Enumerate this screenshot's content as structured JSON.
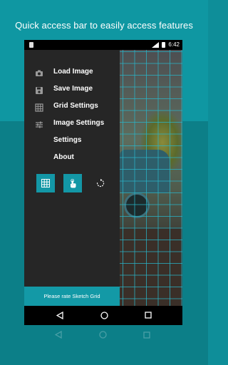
{
  "headline": "Quick access bar to easily access features",
  "status_bar": {
    "time": "6:42"
  },
  "drawer": {
    "items": [
      {
        "label": "Load Image",
        "icon": "camera-icon"
      },
      {
        "label": "Save Image",
        "icon": "save-icon"
      },
      {
        "label": "Grid Settings",
        "icon": "grid-icon"
      },
      {
        "label": "Image Settings",
        "icon": "sliders-icon"
      },
      {
        "label": "Settings",
        "icon": ""
      },
      {
        "label": "About",
        "icon": ""
      }
    ],
    "tools": [
      {
        "name": "grid-toggle",
        "icon": "grid-icon",
        "active": true
      },
      {
        "name": "touch-lock",
        "icon": "touch-icon",
        "active": true
      },
      {
        "name": "rotate",
        "icon": "rotate-icon",
        "active": false
      }
    ],
    "rate_label": "Please rate Sketch Grid"
  },
  "colors": {
    "accent": "#1399a6",
    "drawer_bg": "#262626",
    "background": "#0f97a2"
  }
}
